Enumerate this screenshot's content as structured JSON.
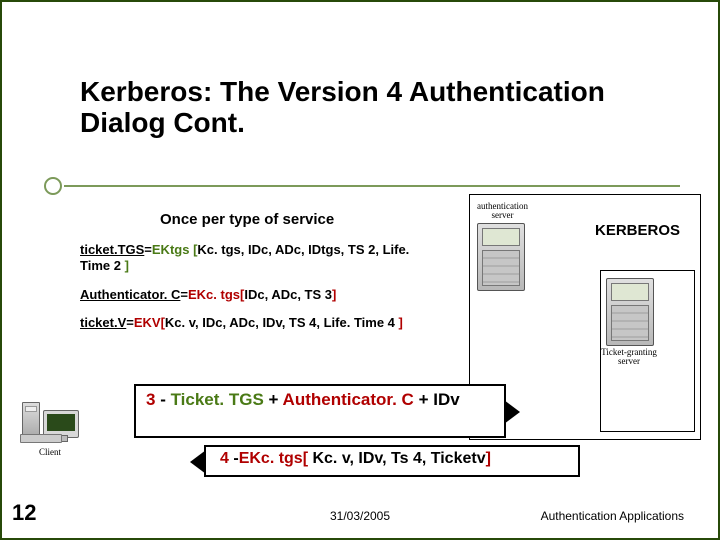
{
  "slide": {
    "title": "Kerberos: The Version 4 Authentication Dialog Cont.",
    "subheading": "Once per type of service",
    "kerberos_label": "KERBEROS",
    "defs": {
      "ticket_tgs_label": "ticket.TGS",
      "ticket_tgs_eq": "=",
      "ticket_tgs_key": "EKtgs ",
      "ticket_tgs_open": "[",
      "ticket_tgs_body": "Kc. tgs, IDc, ADc, IDtgs, TS 2, Life. Time 2 ",
      "ticket_tgs_close": "]",
      "auth_c_label": "Authenticator. C",
      "auth_c_eq": "=",
      "auth_c_key": "EKc. tgs[",
      "auth_c_body": "IDc, ADc, TS 3",
      "auth_c_close": "]",
      "ticket_v_label": "ticket.V",
      "ticket_v_eq": "=",
      "ticket_v_key": "EKV[",
      "ticket_v_body": "Kc. v, IDc, ADc, IDv, TS 4, Life. Time 4 ",
      "ticket_v_close": "]"
    },
    "captions": {
      "client": "Client",
      "auth_server": "authentication\nserver",
      "tgs": "Ticket-granting\nserver"
    },
    "arrow1": {
      "num": "3",
      "dash": " - ",
      "a": "Ticket. TGS",
      "plus1": " + ",
      "b": "Authenticator. C",
      "plus2": " + ",
      "c": "IDv"
    },
    "arrow2": {
      "num": "4",
      "dash": " -",
      "key": "EKc. tgs[",
      "body": " Kc. v, IDv, Ts 4, Ticketv",
      "close": "]"
    },
    "page_number": "12",
    "date": "31/03/2005",
    "footer_app": "Authentication Applications"
  }
}
